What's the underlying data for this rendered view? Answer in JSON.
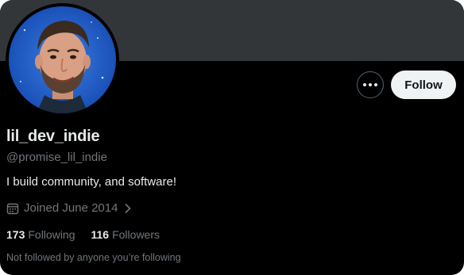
{
  "profile": {
    "display_name": "lil_dev_indie",
    "handle": "@promise_lil_indie",
    "bio": "I build community, and software!",
    "joined": "Joined June 2014",
    "following_count": "173",
    "following_label": "Following",
    "followers_count": "116",
    "followers_label": "Followers",
    "mutuals_note": "Not followed by anyone you’re following"
  },
  "actions": {
    "follow_label": "Follow"
  },
  "icons": {
    "more": "more-horizontal-icon",
    "calendar": "calendar-icon",
    "chevron": "chevron-right-icon"
  },
  "colors": {
    "background": "#000000",
    "banner": "#333639",
    "primary_text": "#e7e9ea",
    "secondary_text": "#71767b",
    "follow_button_bg": "#eff3f4"
  }
}
